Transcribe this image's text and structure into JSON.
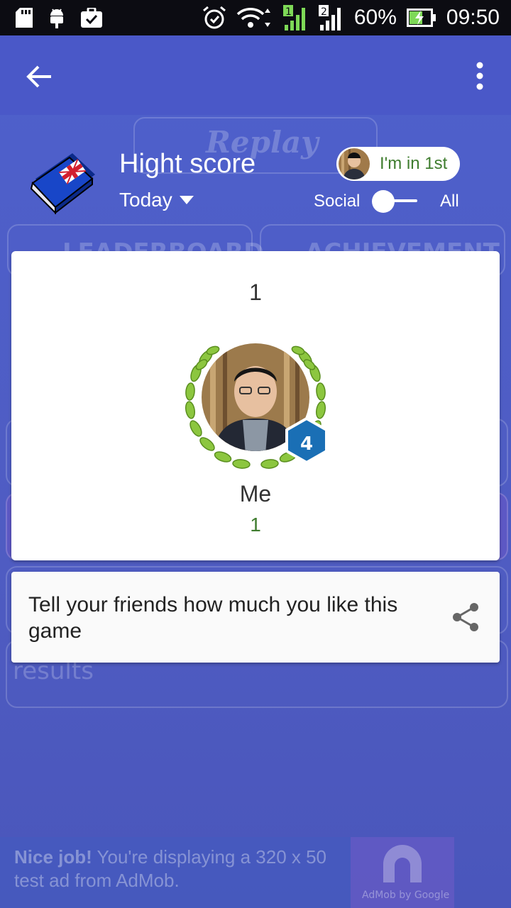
{
  "status_bar": {
    "battery": "60%",
    "time": "09:50"
  },
  "background": {
    "replay_label": "Replay",
    "leaderboard_label": "LEADERBOARD",
    "achievement_label": "ACHIEVEMENT",
    "results_label": "results"
  },
  "header": {
    "title": "Hight score",
    "time_filter": "Today",
    "rank_badge": "I'm in 1st",
    "social_label": "Social",
    "all_label": "All"
  },
  "leaderboard": {
    "entries": [
      {
        "rank": "1",
        "name": "Me",
        "score": "1",
        "level": "4"
      }
    ]
  },
  "share": {
    "text": "Tell your friends how much you like this game"
  },
  "ad": {
    "bold": "Nice job!",
    "text": " You're displaying a 320 x 50 test ad from AdMob.",
    "logo_text": "AdMob by Google"
  },
  "colors": {
    "primary": "#4a58c8",
    "accent_green": "#3f7d2f",
    "badge_blue": "#1a6fb5"
  }
}
